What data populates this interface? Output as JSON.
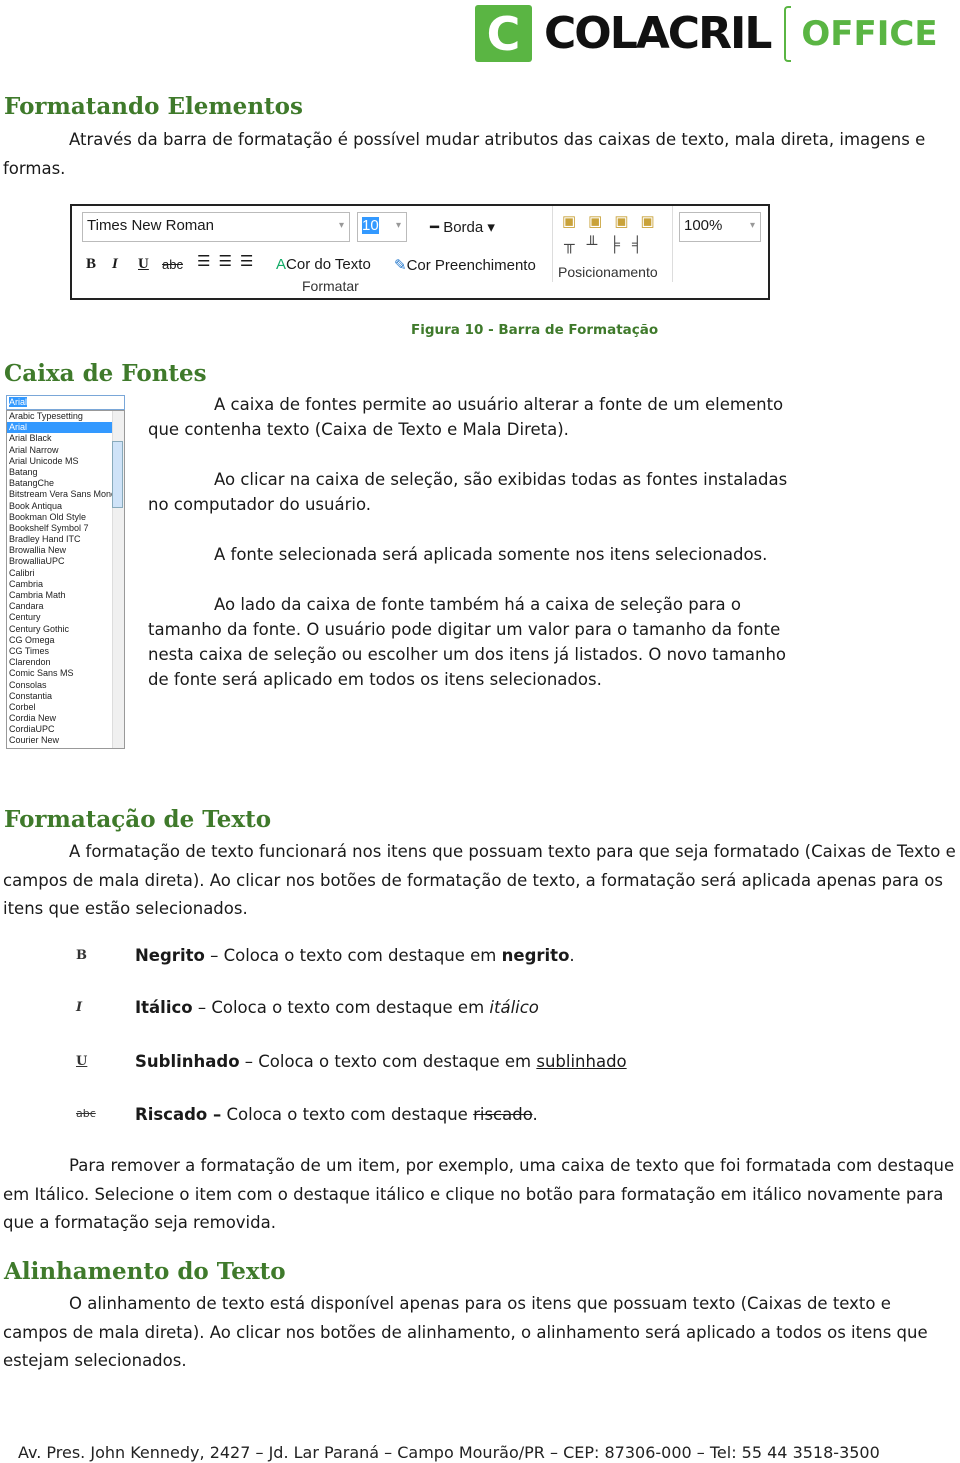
{
  "logo": {
    "mark": "C",
    "name": "COLACRIL",
    "sub": "OFFICE"
  },
  "s1": {
    "title": "Formatando Elementos",
    "text": "Através da barra de formatação é possível mudar atributos das caixas de texto, mala direta, imagens e formas."
  },
  "toolbar": {
    "font": "Times New Roman",
    "size": "10",
    "border": "Borda",
    "bold": "B",
    "italic": "I",
    "underline": "U",
    "strike": "abc",
    "text_color": "Cor do Texto",
    "fill_color": "Cor Preenchimento",
    "group_format": "Formatar",
    "group_position": "Posicionamento",
    "zoom": "100%"
  },
  "caption": "Figura 10 - Barra de Formatação",
  "s2": {
    "title": "Caixa de Fontes",
    "p1": "A caixa de fontes permite ao usuário alterar a fonte de um elemento que contenha texto (Caixa de Texto e Mala Direta).",
    "p2": "Ao clicar na caixa de seleção, são exibidas todas as fontes instaladas no computador do usuário.",
    "p3": "A fonte selecionada será aplicada somente nos itens selecionados.",
    "p4": "Ao lado da caixa de fonte também há a caixa de seleção para o tamanho da fonte. O usuário pode digitar um valor para o tamanho da fonte nesta caixa de seleção ou escolher um dos itens já listados. O novo tamanho de fonte será aplicado em todos os itens selecionados."
  },
  "fontlist": {
    "selected": "Arial",
    "items": [
      "Arabic Typesetting",
      "Arial",
      "Arial Black",
      "Arial Narrow",
      "Arial Unicode MS",
      "Batang",
      "BatangChe",
      "Bitstream Vera Sans Mono",
      "Book Antiqua",
      "Bookman Old Style",
      "Bookshelf Symbol 7",
      "Bradley Hand ITC",
      "Browallia New",
      "BrowalliaUPC",
      "Calibri",
      "Cambria",
      "Cambria Math",
      "Candara",
      "Century",
      "Century Gothic",
      "CG Omega",
      "CG Times",
      "Clarendon",
      "Comic Sans MS",
      "Consolas",
      "Constantia",
      "Corbel",
      "Cordia New",
      "CordiaUPC",
      "Courier New"
    ]
  },
  "s3": {
    "title": "Formatação de Texto",
    "text": "A formatação de texto funcionará nos itens que possuam texto para que seja formatado (Caixas de Texto e campos de mala direta). Ao clicar nos botões de formatação de texto, a formatação será aplicada apenas para os itens que estão selecionados.",
    "items": [
      {
        "icon": "B",
        "name": "Negrito",
        "sep": " – ",
        "desc": "Coloca o texto com destaque em ",
        "ex": "negrito",
        "end": "."
      },
      {
        "icon": "I",
        "name": "Itálico",
        "sep": " – ",
        "desc": "Coloca o texto com destaque em ",
        "ex": "itálico",
        "end": ""
      },
      {
        "icon": "U",
        "name": "Sublinhado",
        "sep": " – ",
        "desc": "Coloca o texto com destaque em ",
        "ex": "sublinhado",
        "end": ""
      },
      {
        "icon": "abc",
        "name": "Riscado –",
        "sep": " ",
        "desc": "Coloca o texto com destaque ",
        "ex": "riscado",
        "end": "."
      }
    ],
    "after": "Para remover a formatação de um item, por exemplo, uma caixa de texto que foi formatada com destaque em Itálico. Selecione o item com o destaque itálico e clique no botão para formatação em itálico novamente para que a formatação seja removida."
  },
  "s4": {
    "title": "Alinhamento do Texto",
    "text": "O alinhamento de texto está disponível apenas para os itens que possuam texto (Caixas de texto e campos de mala direta). Ao clicar nos botões de alinhamento, o alinhamento será aplicado a todos os itens que estejam selecionados."
  },
  "footer": "Av. Pres. John Kennedy, 2427 – Jd. Lar Paraná – Campo Mourão/PR – CEP: 87306-000 – Tel: 55 44 3518-3500",
  "colors": {
    "heading": "#3f7a2b",
    "brand": "#5ab543"
  }
}
